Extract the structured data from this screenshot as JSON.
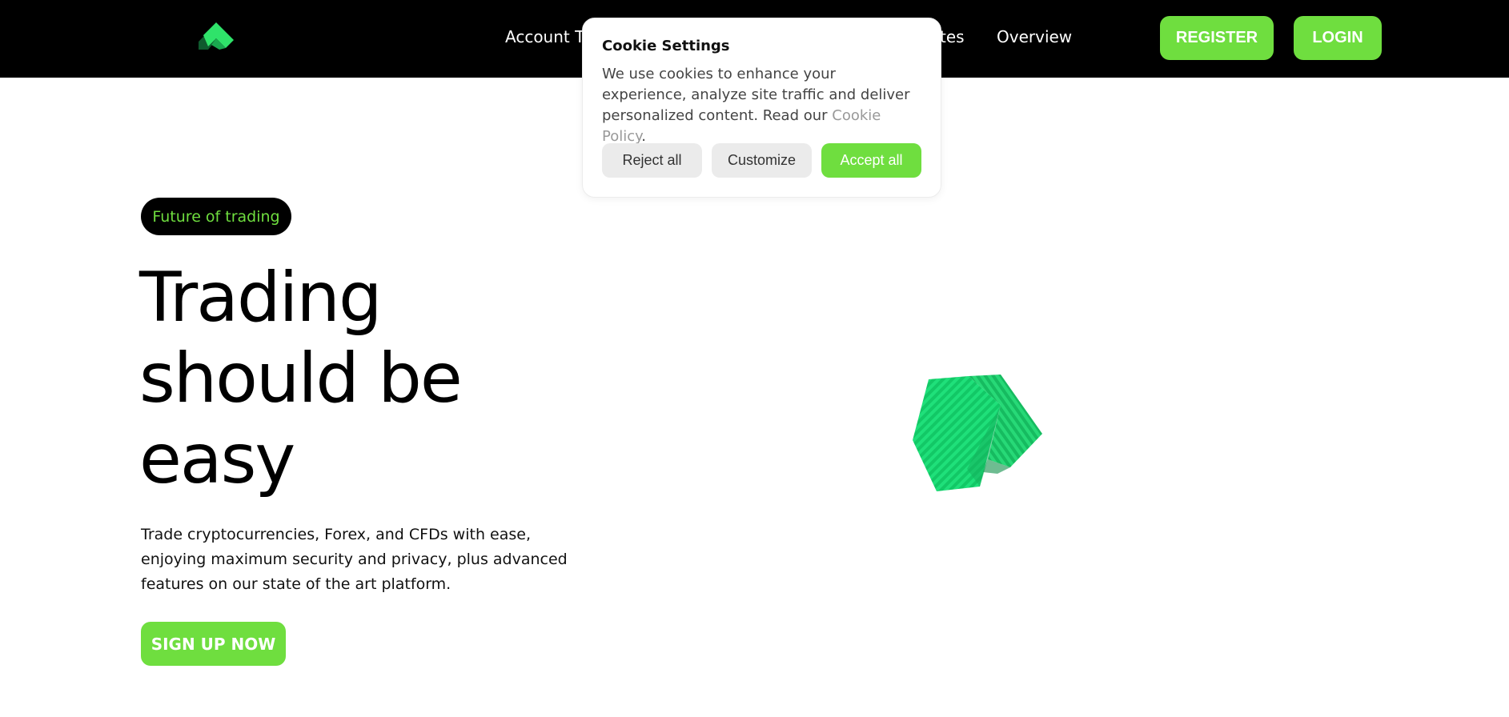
{
  "nav": {
    "links": [
      "Account T",
      "tes",
      "Overview"
    ],
    "register_label": "REGISTER",
    "login_label": "LOGIN"
  },
  "hero": {
    "badge": "Future of trading",
    "title_lines": [
      "Trading",
      "should be",
      "easy"
    ],
    "subtitle": "Trade cryptocurrencies, Forex, and CFDs with ease, enjoying maximum security and privacy, plus advanced features on our state of the art platform.",
    "cta_label": "SIGN UP NOW"
  },
  "cookie": {
    "title": "Cookie Settings",
    "text_before": "We use cookies to enhance your experience, analyze site traffic and deliver personalized content. Read our ",
    "link_text": "Cookie Policy",
    "text_after": ".",
    "reject_label": "Reject all",
    "customize_label": "Customize",
    "accept_label": "Accept all"
  },
  "colors": {
    "accent": "#6fde3f",
    "nav_bg": "#000000",
    "cube": "#1fe07a"
  },
  "icons": {
    "logo": "logo-icon",
    "cube": "cube-graphic"
  }
}
